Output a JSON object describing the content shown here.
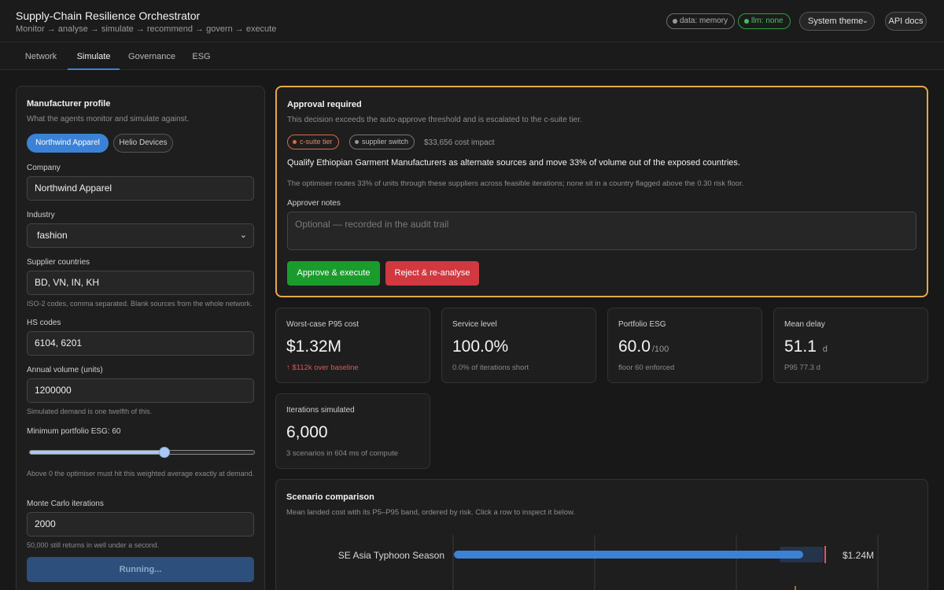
{
  "header": {
    "title": "Supply-Chain Resilience Orchestrator",
    "subtitle": "Monitor → analyse → simulate → recommend → govern → execute",
    "data_pill": "data: memory",
    "llm_pill": "llm: none",
    "theme": "System theme",
    "api_docs": "API docs"
  },
  "tabs": [
    {
      "label": "Network",
      "active": false
    },
    {
      "label": "Simulate",
      "active": true
    },
    {
      "label": "Governance",
      "active": false
    },
    {
      "label": "ESG",
      "active": false
    }
  ],
  "profile": {
    "title": "Manufacturer profile",
    "subtitle": "What the agents monitor and simulate against.",
    "presets": [
      "Northwind Apparel",
      "Helio Devices"
    ],
    "company_label": "Company",
    "company_value": "Northwind Apparel",
    "industry_label": "Industry",
    "industry_value": "fashion",
    "countries_label": "Supplier countries",
    "countries_value": "BD, VN, IN, KH",
    "countries_help": "ISO-2 codes, comma separated. Blank sources from the whole network.",
    "hs_label": "HS codes",
    "hs_value": "6104, 6201",
    "volume_label": "Annual volume (units)",
    "volume_value": "1200000",
    "volume_help": "Simulated demand is one twelfth of this.",
    "esg_label": "Minimum portfolio ESG: 60",
    "esg_min_value": 60,
    "esg_help": "Above 0 the optimiser must hit this weighted average exactly at demand.",
    "iterations_label": "Monte Carlo iterations",
    "iterations_value": "2000",
    "iterations_help": "50,000 still returns in well under a second.",
    "run_button": "Running..."
  },
  "approval": {
    "title": "Approval required",
    "subtitle": "This decision exceeds the auto-approve threshold and is escalated to the c-suite tier.",
    "tag_tier": "c-suite tier",
    "tag_switch": "supplier switch",
    "cost_impact": "$33,656 cost impact",
    "recommendation": "Qualify Ethiopian Garment Manufacturers as alternate sources and move 33% of volume out of the exposed countries.",
    "note": "The optimiser routes 33% of units through these suppliers across feasible iterations; none sit in a country flagged above the 0.30 risk floor.",
    "notes_label": "Approver notes",
    "notes_placeholder": "Optional — recorded in the audit trail",
    "approve_button": "Approve & execute",
    "reject_button": "Reject & re-analyse"
  },
  "kpis": {
    "p95_cost": {
      "label": "Worst-case P95 cost",
      "value": "$1.32M",
      "note": "↑ $112k over baseline"
    },
    "service": {
      "label": "Service level",
      "value": "100.0%",
      "note": "0.0% of iterations short"
    },
    "esg": {
      "label": "Portfolio ESG",
      "value": "60.0",
      "unit": "/100",
      "note": "floor 60 enforced"
    },
    "delay": {
      "label": "Mean delay",
      "value": "51.1",
      "unit": "d",
      "note": "P95 77.3 d"
    },
    "iterations": {
      "label": "Iterations simulated",
      "value": "6,000",
      "note": "3 scenarios in 604 ms of compute"
    }
  },
  "scenario": {
    "title": "Scenario comparison",
    "subtitle": "Mean landed cost with its P5–P95 band, ordered by risk. Click a row to inspect it below.",
    "rows": [
      {
        "name": "SE Asia Typhoon Season",
        "label": "$1.24M"
      }
    ]
  },
  "colors": {
    "accent": "#3b82d6",
    "approval_border": "#e6a84a",
    "approve": "#1a9c2d",
    "reject": "#d1383f",
    "negative": "#e0555a"
  }
}
